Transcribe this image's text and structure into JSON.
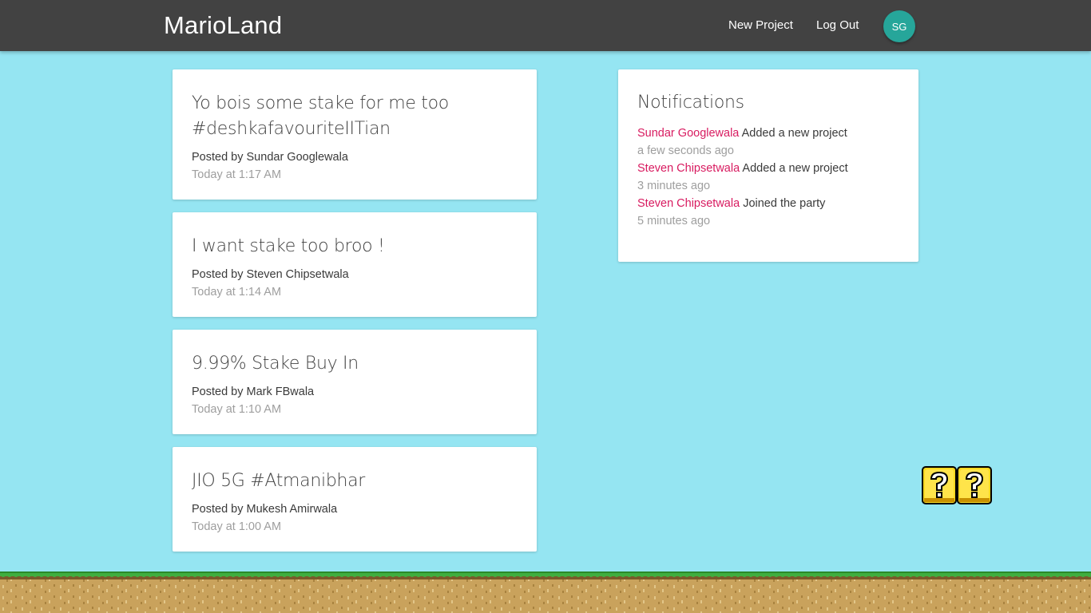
{
  "navbar": {
    "brand": "MarioLand",
    "links": [
      {
        "label": "New Project"
      },
      {
        "label": "Log Out"
      }
    ],
    "avatar_initials": "SG",
    "background": "#424242",
    "avatar_color": "#26a69a"
  },
  "projects": [
    {
      "title": "Yo bois some stake for me too #deshkafavouriteIITian",
      "author": "Posted by Sundar Googlewala",
      "time": "Today at 1:17 AM"
    },
    {
      "title": "I want stake too broo !",
      "author": "Posted by Steven Chipsetwala",
      "time": "Today at 1:14 AM"
    },
    {
      "title": "9.99% Stake Buy In",
      "author": "Posted by Mark FBwala",
      "time": "Today at 1:10 AM"
    },
    {
      "title": "JIO 5G #Atmanibhar",
      "author": "Posted by Mukesh Amirwala",
      "time": "Today at 1:00 AM"
    }
  ],
  "notifications": {
    "title": "Notifications",
    "items": [
      {
        "user": "Sundar Googlewala",
        "action": "Added a new project",
        "time": "a few seconds ago"
      },
      {
        "user": "Steven Chipsetwala",
        "action": "Added a new project",
        "time": "3 minutes ago"
      },
      {
        "user": "Steven Chipsetwala",
        "action": "Joined the party",
        "time": "5 minutes ago"
      }
    ]
  },
  "decor": {
    "question_blocks": "question-block-icon",
    "ground": "grass-dirt-ground",
    "sky_color": "#95e5f2",
    "accent_user_color": "#d81b60"
  }
}
